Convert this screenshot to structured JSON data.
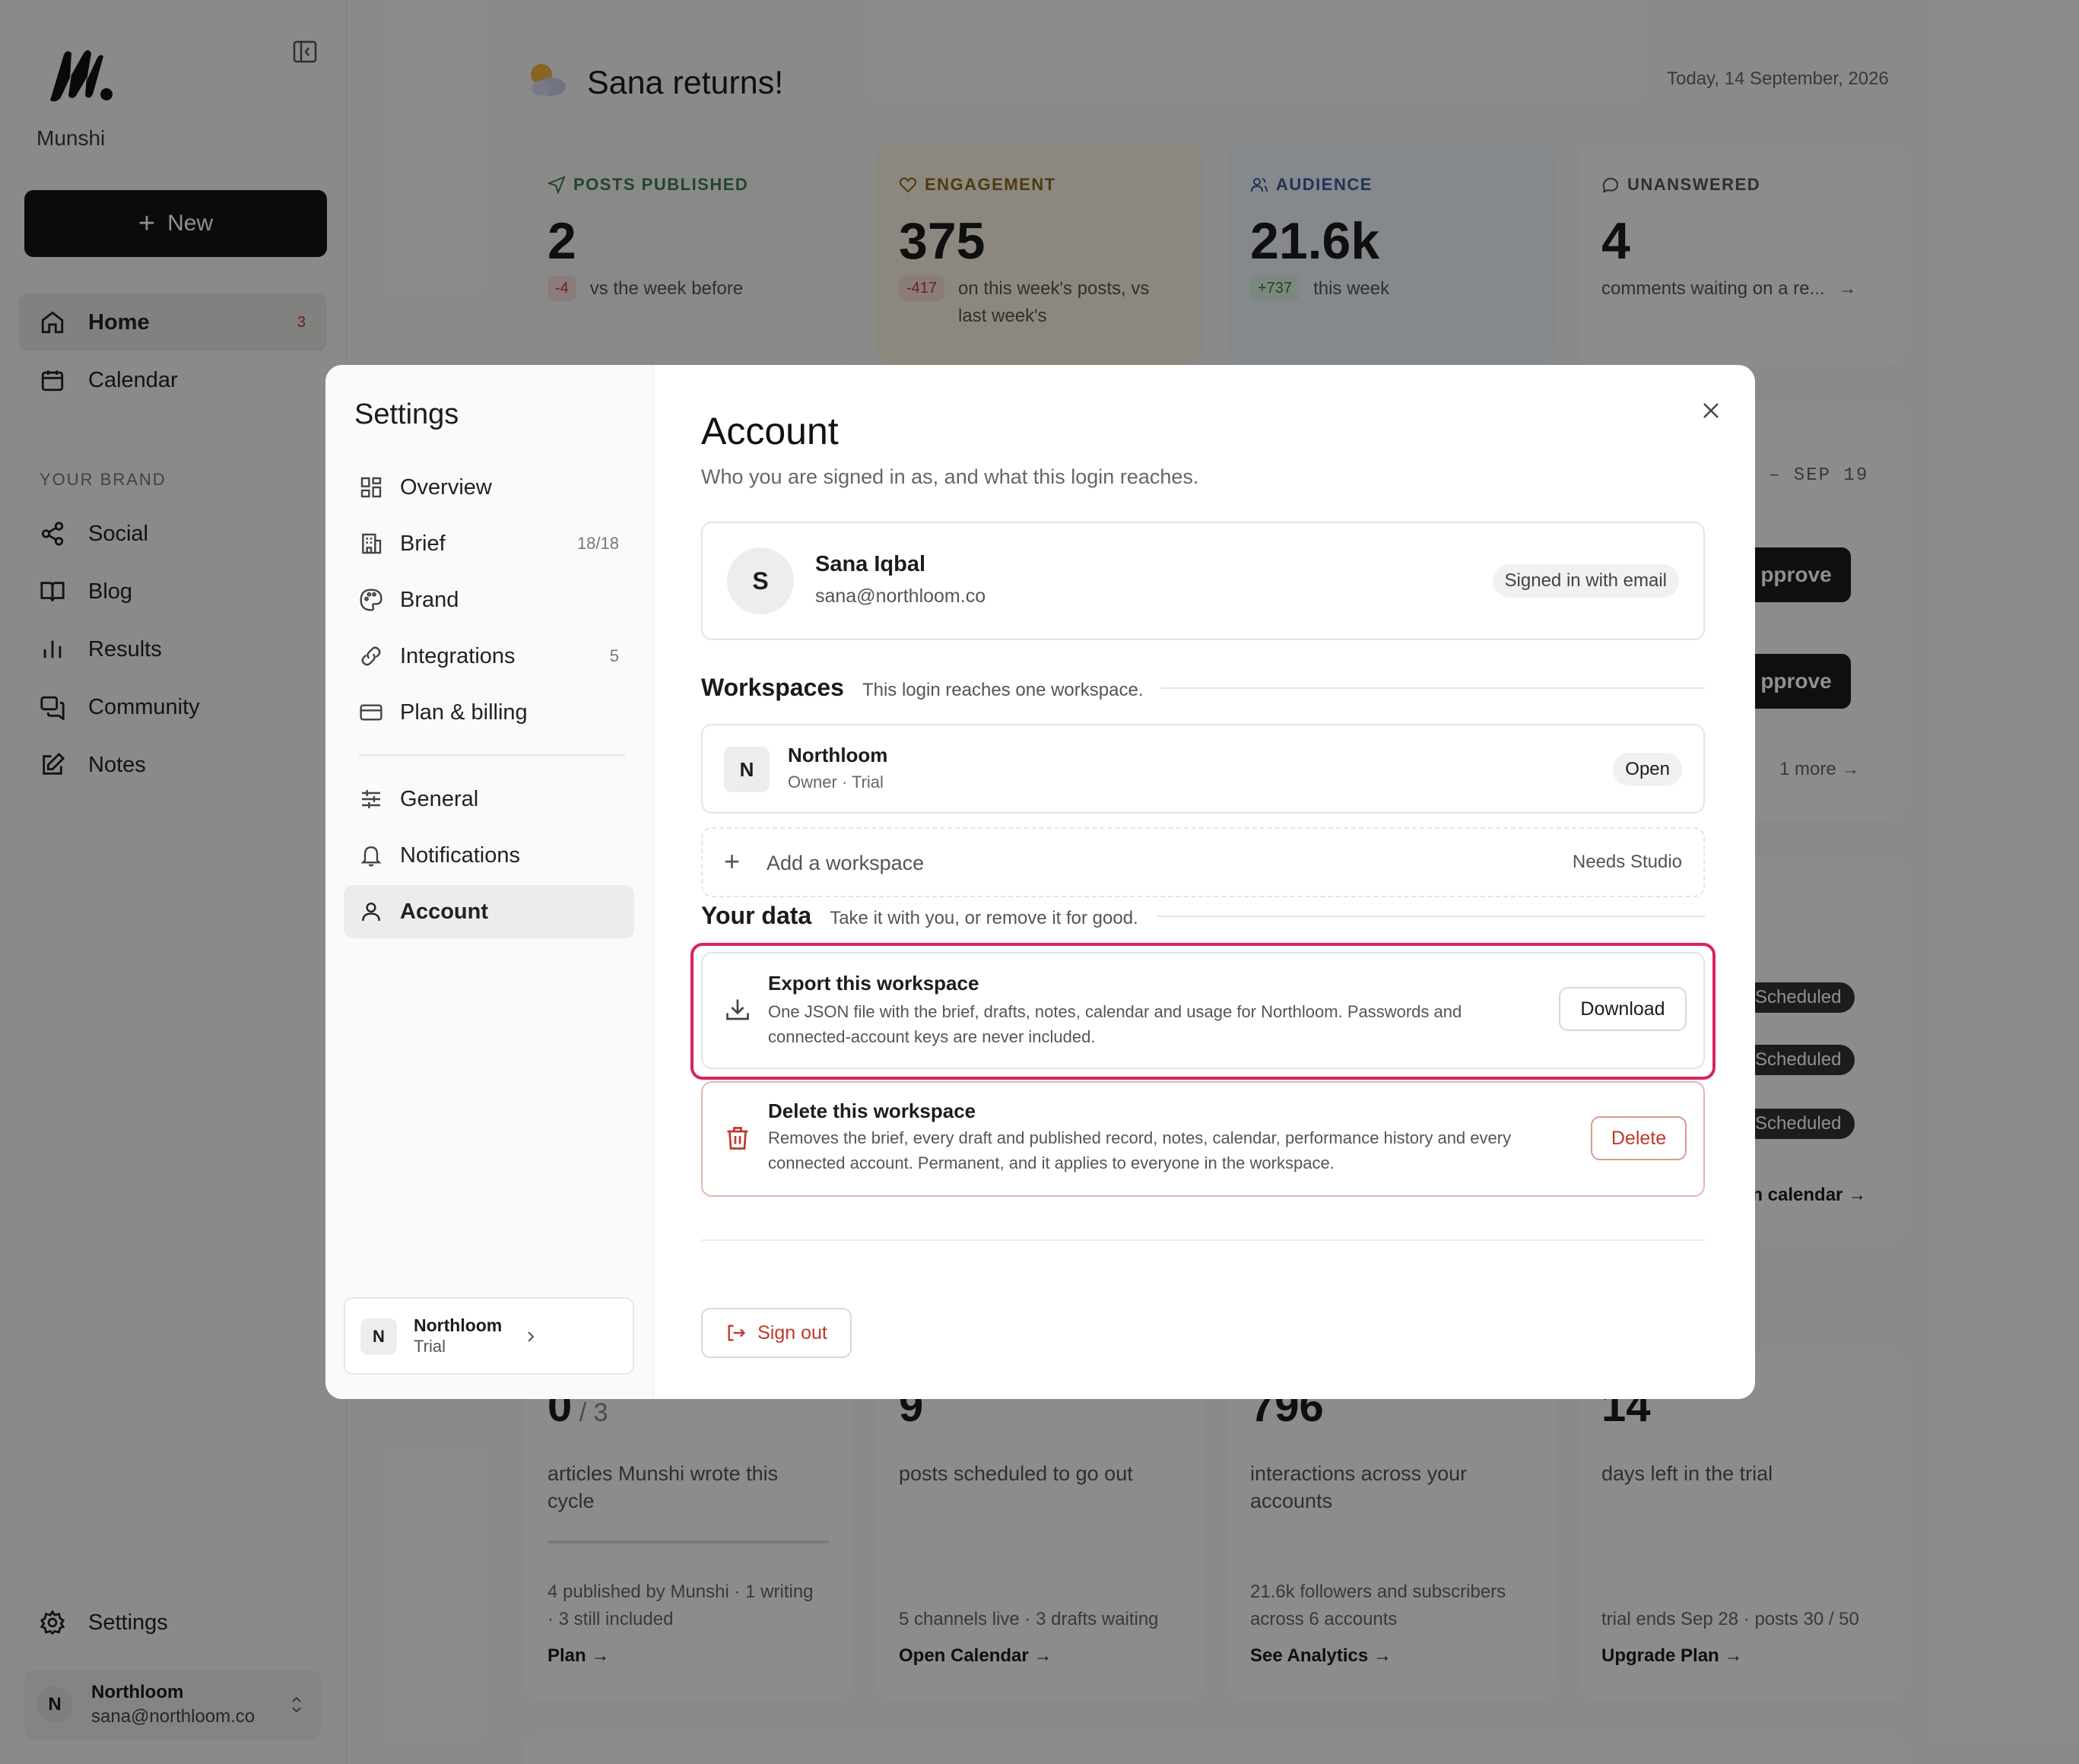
{
  "app": {
    "name": "Munshi"
  },
  "sidebar": {
    "new_label": "New",
    "items": [
      {
        "label": "Home",
        "icon": "home-icon",
        "badge": "3",
        "active": true
      },
      {
        "label": "Calendar",
        "icon": "calendar-icon"
      }
    ],
    "section_label": "YOUR BRAND",
    "brand_items": [
      {
        "label": "Social",
        "icon": "share-icon"
      },
      {
        "label": "Blog",
        "icon": "book-icon"
      },
      {
        "label": "Results",
        "icon": "bar-chart-icon"
      },
      {
        "label": "Community",
        "icon": "chat-icon"
      },
      {
        "label": "Notes",
        "icon": "edit-icon"
      }
    ],
    "settings_label": "Settings",
    "user": {
      "initial": "N",
      "name": "Northloom",
      "email": "sana@northloom.co"
    }
  },
  "header": {
    "greeting": "Sana returns!",
    "date": "Today, 14 September, 2026"
  },
  "kpis": [
    {
      "label": "POSTS PUBLISHED",
      "value": "2",
      "delta": "-4",
      "note": "vs the week before",
      "color": "#3f7a4f"
    },
    {
      "label": "ENGAGEMENT",
      "value": "375",
      "delta": "-417",
      "note": "on this week's posts, vs last week's",
      "color": "#8a6a1c"
    },
    {
      "label": "AUDIENCE",
      "value": "21.6k",
      "delta": "+737",
      "note": "this week",
      "color": "#3c5a9a"
    },
    {
      "label": "UNANSWERED",
      "value": "4",
      "note": "comments waiting on a re...",
      "color": "#555555"
    }
  ],
  "week_panel": {
    "range": "– SEP 19",
    "approve_label": "pprove",
    "more": "1 more",
    "statuses": [
      "Scheduled",
      "Scheduled",
      "Scheduled"
    ],
    "calendar_link": "en calendar →"
  },
  "bottom_cards": [
    {
      "value": "0",
      "total": "/ 3",
      "desc": "articles Munshi wrote this cycle",
      "foot": "4 published by Munshi · 1 writing · 3 still included",
      "link": "Plan →"
    },
    {
      "value": "9",
      "desc": "posts scheduled to go out",
      "foot": "5 channels live · 3 drafts waiting",
      "link": "Open Calendar →"
    },
    {
      "value": "796",
      "desc": "interactions across your accounts",
      "foot": "21.6k followers and subscribers across 6 accounts",
      "link": "See Analytics →"
    },
    {
      "value": "14",
      "desc": "days left in the trial",
      "foot": "trial ends Sep 28 · posts 30 / 50",
      "link": "Upgrade Plan →"
    }
  ],
  "settings": {
    "title": "Settings",
    "nav": [
      {
        "label": "Overview",
        "icon": "grid-icon"
      },
      {
        "label": "Brief",
        "icon": "building-icon",
        "count": "18/18"
      },
      {
        "label": "Brand",
        "icon": "palette-icon"
      },
      {
        "label": "Integrations",
        "icon": "link-icon",
        "count": "5"
      },
      {
        "label": "Plan & billing",
        "icon": "credit-card-icon"
      }
    ],
    "nav2": [
      {
        "label": "General",
        "icon": "sliders-icon"
      },
      {
        "label": "Notifications",
        "icon": "bell-icon"
      },
      {
        "label": "Account",
        "icon": "user-icon",
        "active": true
      }
    ],
    "workspace": {
      "initial": "N",
      "name": "Northloom",
      "plan": "Trial"
    }
  },
  "account": {
    "title": "Account",
    "subtitle": "Who you are signed in as, and what this login reaches.",
    "user": {
      "initial": "S",
      "name": "Sana Iqbal",
      "email": "sana@northloom.co",
      "method": "Signed in with email"
    },
    "workspaces": {
      "title": "Workspaces",
      "desc": "This login reaches one workspace.",
      "items": [
        {
          "initial": "N",
          "name": "Northloom",
          "role": "Owner · Trial",
          "action": "Open"
        }
      ],
      "add_label": "Add a workspace",
      "add_note": "Needs Studio"
    },
    "data": {
      "title": "Your data",
      "desc": "Take it with you, or remove it for good.",
      "export": {
        "title": "Export this workspace",
        "desc": "One JSON file with the brief, drafts, notes, calendar and usage for Northloom. Passwords and connected-account keys are never included.",
        "button": "Download"
      },
      "delete": {
        "title": "Delete this workspace",
        "desc": "Removes the brief, every draft and published record, notes, calendar, performance history and every connected account. Permanent, and it applies to everyone in the workspace.",
        "button": "Delete"
      }
    },
    "signout_label": "Sign out"
  },
  "colors": {
    "accent_dark": "#141414",
    "danger": "#c0392b",
    "highlight": "#d6245e",
    "positive": "#2e7d46"
  }
}
